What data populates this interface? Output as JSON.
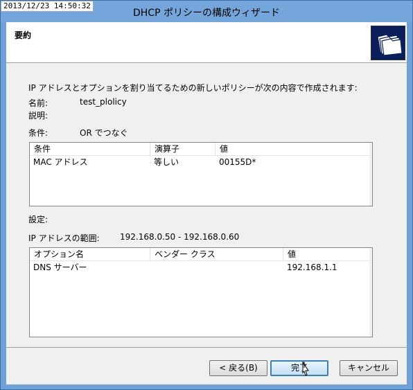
{
  "timestamp": "2013/12/23 14:50:32",
  "window": {
    "title": "DHCP ポリシーの構成ウィザード"
  },
  "header": {
    "title": "要約",
    "icon": "folders-icon"
  },
  "summary": {
    "intro": "IP アドレスとオプションを割り当てるための新しいポリシーが次の内容で作成されます:",
    "name_label": "名前:",
    "name_value": "test_plolicy",
    "description_label": "説明:",
    "description_value": "",
    "condition_label": "条件:",
    "condition_value": "OR でつなぐ"
  },
  "conditions_table": {
    "columns": [
      "条件",
      "演算子",
      "値"
    ],
    "rows": [
      [
        "MAC アドレス",
        "等しい",
        "00155D*"
      ]
    ]
  },
  "settings": {
    "label": "設定:",
    "ip_range_label": "IP アドレスの範囲:",
    "ip_range_value": "192.168.0.50 - 192.168.0.60"
  },
  "options_table": {
    "columns": [
      "オプション名",
      "ベンダー クラス",
      "値"
    ],
    "rows": [
      [
        "DNS サーバー",
        "",
        "192.168.1.1"
      ]
    ]
  },
  "buttons": {
    "back": "< 戻る(B)",
    "finish": "完了",
    "cancel": "キャンセル"
  }
}
